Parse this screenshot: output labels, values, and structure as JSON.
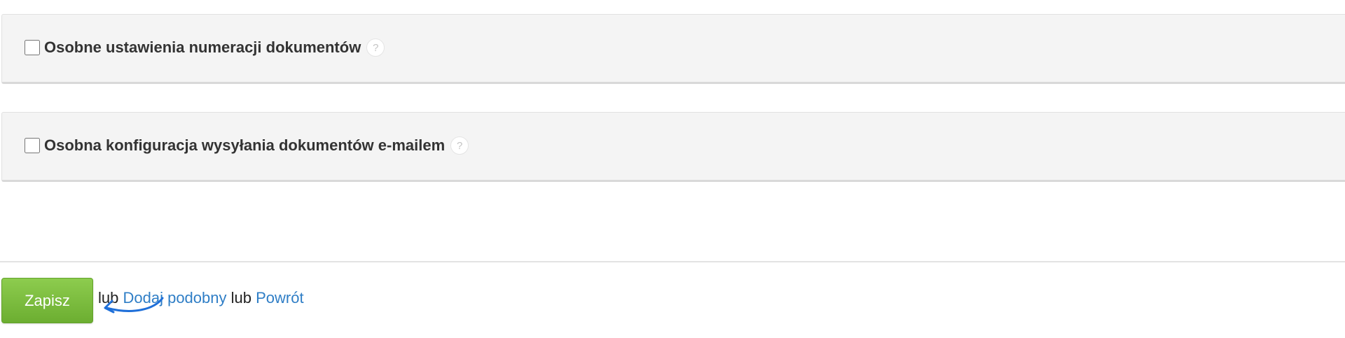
{
  "panels": [
    {
      "label": "Osobne ustawienia numeracji dokumentów",
      "checked": false,
      "help_icon": "help-icon",
      "help_text": "?"
    },
    {
      "label": "Osobna konfiguracja wysyłania dokumentów e-mailem",
      "checked": false,
      "help_icon": "help-icon",
      "help_text": "?"
    }
  ],
  "footer": {
    "save_label": "Zapisz",
    "separator_1": "lub",
    "add_similar_link": "Dodaj podobny",
    "separator_2": "lub",
    "back_link": "Powrót"
  },
  "colors": {
    "panel_background": "#f4f4f4",
    "save_button": "#7bbf3d",
    "link": "#2f7ec6",
    "annotation_arrow": "#1e6fd9"
  },
  "annotation": {
    "icon": "curved-arrow-icon"
  }
}
